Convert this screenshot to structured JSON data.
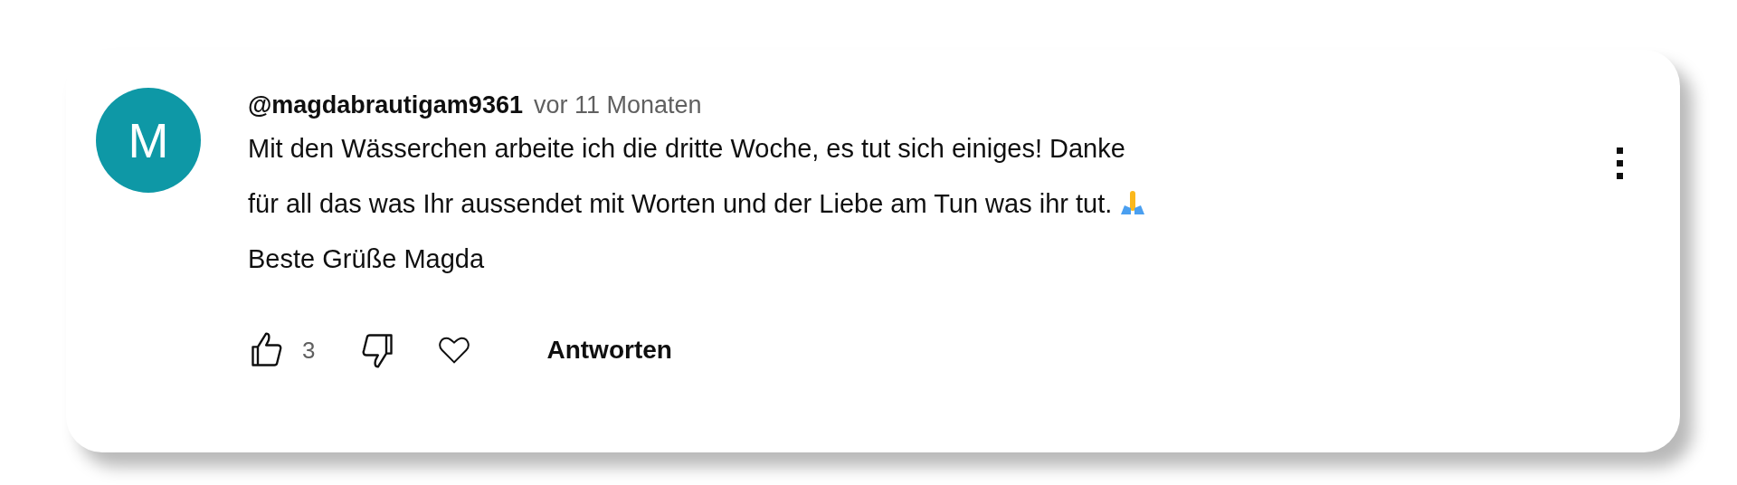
{
  "comment": {
    "avatar_letter": "M",
    "author": "@magdabrautigam9361",
    "time": "vor 11 Monaten",
    "text": "Mit den Wässerchen arbeite ich die dritte Woche, es tut sich einiges! Danke\nfür all das was Ihr aussendet mit Worten und der Liebe am Tun was ihr tut.",
    "text_after_emoji": "Beste Grüße Magda",
    "likes": "3",
    "hearted": false,
    "reply_label": "Antworten"
  }
}
